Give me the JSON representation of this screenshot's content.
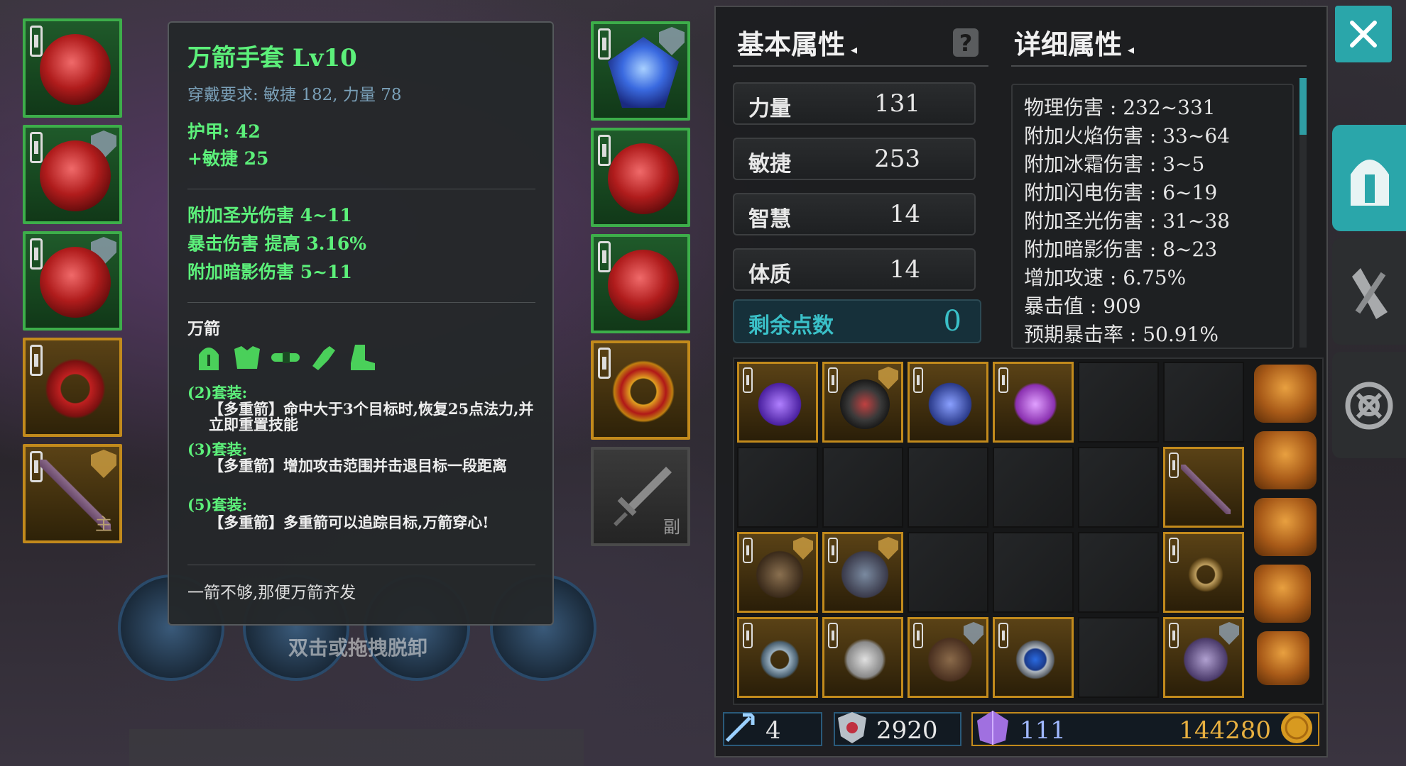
{
  "tooltip": {
    "title": "万箭手套 Lv10",
    "requirement": "穿戴要求:  敏捷 182, 力量 78",
    "armor": "护甲:  42",
    "agility_bonus": "+敏捷 25",
    "affixes": [
      "附加圣光伤害  4~11",
      "暴击伤害  提高  3.16%",
      "附加暗影伤害  5~11"
    ],
    "set_name": "万箭",
    "set_bonuses": [
      {
        "header": "(2)套装:",
        "text": "【多重箭】命中大于3个目标时,恢复25点法力,并立即重置技能"
      },
      {
        "header": "(3)套装:",
        "text": "【多重箭】增加攻击范围并击退目标一段距离"
      },
      {
        "header": "(5)套装:",
        "text": "【多重箭】多重箭可以追踪目标,万箭穿心!"
      }
    ],
    "flavor": "一箭不够,那便万箭齐发"
  },
  "slots": {
    "main_hand_tag": "主",
    "off_hand_tag": "副"
  },
  "basic": {
    "title": "基本属性",
    "stats": [
      {
        "label": "力量",
        "value": "131"
      },
      {
        "label": "敏捷",
        "value": "253"
      },
      {
        "label": "智慧",
        "value": "14"
      },
      {
        "label": "体质",
        "value": "14"
      }
    ],
    "free_points_label": "剩余点数",
    "free_points": "0"
  },
  "detail": {
    "title": "详细属性",
    "rows": [
      "物理伤害 : 232~331",
      "附加火焰伤害 : 33~64",
      "附加冰霜伤害 : 3~5",
      "附加闪电伤害 : 6~19",
      "附加圣光伤害 : 31~38",
      "附加暗影伤害 : 8~23",
      "增加攻速 : 6.75%",
      "暴击值 : 909",
      "预期暴击率 : 50.91%"
    ]
  },
  "currency": {
    "arrows": "4",
    "honor": "2920",
    "gems": "111",
    "gold": "144280"
  },
  "hint": "双击或拖拽脱卸",
  "colors": {
    "accent": "#2aa6aa",
    "green_text": "#5cf07a",
    "gold_border": "#c28a1c",
    "green_border": "#3dae4a"
  },
  "icons": [
    "close-icon",
    "helmet-icon",
    "gloves-icon",
    "target-icon",
    "question-icon",
    "sword-icon"
  ]
}
